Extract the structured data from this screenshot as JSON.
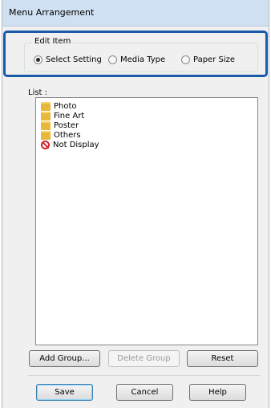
{
  "window": {
    "title": "Menu Arrangement"
  },
  "edit_item": {
    "legend": "Edit Item",
    "options": [
      {
        "label": "Select Setting",
        "checked": true
      },
      {
        "label": "Media Type",
        "checked": false
      },
      {
        "label": "Paper Size",
        "checked": false
      }
    ]
  },
  "list": {
    "label": "List :",
    "items": [
      {
        "label": "Photo",
        "icon": "folder-icon"
      },
      {
        "label": "Fine Art",
        "icon": "folder-icon"
      },
      {
        "label": "Poster",
        "icon": "folder-icon"
      },
      {
        "label": "Others",
        "icon": "folder-icon"
      },
      {
        "label": "Not Display",
        "icon": "no-entry-icon"
      }
    ]
  },
  "buttons": {
    "add_group": "Add Group...",
    "delete_group": "Delete Group",
    "reset": "Reset",
    "save": "Save",
    "cancel": "Cancel",
    "help": "Help"
  },
  "colors": {
    "callout_border": "#1a5aa8",
    "folder": "#e8b83a",
    "no_entry": "#d4262a"
  }
}
